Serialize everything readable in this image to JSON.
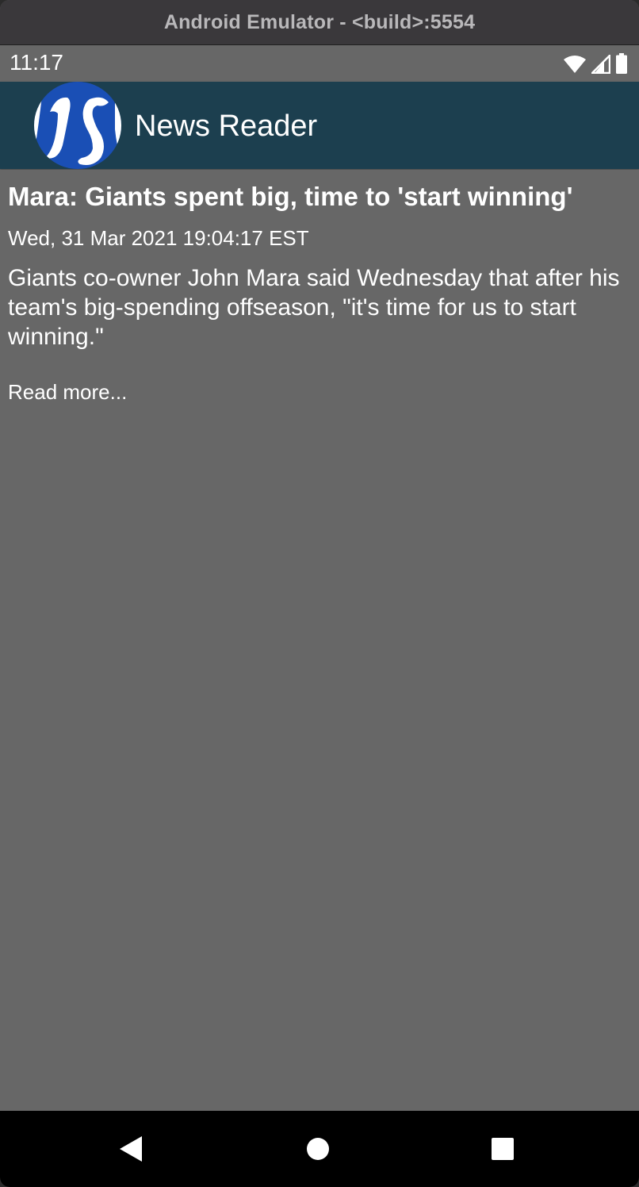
{
  "window": {
    "title": "Android Emulator - <build>:5554"
  },
  "status_bar": {
    "time": "11:17",
    "icons": [
      "wifi-icon",
      "cellular-signal-icon",
      "battery-icon"
    ]
  },
  "app_bar": {
    "title": "News Reader",
    "logo": "js-logo",
    "background_color": "#1c3f4f"
  },
  "article": {
    "headline": "Mara: Giants spent big, time to 'start winning'",
    "date": "Wed, 31 Mar 2021 19:04:17 EST",
    "summary": "Giants co-owner John Mara said Wednesday that after his team's big-spending offseason, \"it's time for us to start winning.\"",
    "read_more": "Read more..."
  },
  "nav_bar": {
    "buttons": [
      "back-icon",
      "home-icon",
      "recents-icon"
    ]
  },
  "colors": {
    "content_background": "#676767",
    "text": "#ffffff",
    "titlebar": "#3a383b"
  }
}
